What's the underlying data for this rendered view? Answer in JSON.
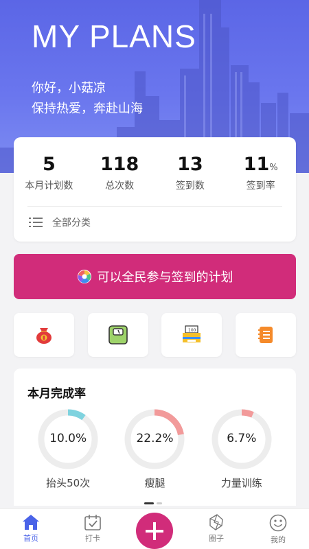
{
  "hero": {
    "title": "MY PLANS",
    "greeting": "你好，小菇凉",
    "slogan": "保持热爱，奔赴山海"
  },
  "stats": [
    {
      "value": "5",
      "unit": "",
      "label": "本月计划数"
    },
    {
      "value": "118",
      "unit": "",
      "label": "总次数"
    },
    {
      "value": "13",
      "unit": "",
      "label": "签到数"
    },
    {
      "value": "11",
      "unit": "%",
      "label": "签到率"
    }
  ],
  "category": {
    "label": "全部分类",
    "icon": "list-icon"
  },
  "banner": {
    "text": "可以全民参与签到的计划",
    "icon": "color-wheel-icon",
    "color": "#d12c7a"
  },
  "tiles": [
    {
      "icon": "money-bag-icon"
    },
    {
      "icon": "scale-icon"
    },
    {
      "icon": "cash-register-icon"
    },
    {
      "icon": "notebook-icon"
    }
  ],
  "progress": {
    "title": "本月完成率",
    "rings": [
      {
        "label": "抬头50次",
        "percent_text": "10.0%",
        "percent": 10.0,
        "color": "#7fd3df"
      },
      {
        "label": "瘦腿",
        "percent_text": "22.2%",
        "percent": 22.2,
        "color": "#f29a9a"
      },
      {
        "label": "力量训练",
        "percent_text": "6.7%",
        "percent": 6.7,
        "color": "#f29a9a"
      }
    ]
  },
  "tabbar": {
    "tabs": [
      {
        "label": "首页",
        "icon": "home-icon",
        "active": true
      },
      {
        "label": "打卡",
        "icon": "calendar-check-icon",
        "active": false
      },
      {
        "label": "",
        "icon": "plus-icon",
        "active": false
      },
      {
        "label": "圈子",
        "icon": "aperture-icon",
        "active": false
      },
      {
        "label": "我的",
        "icon": "smile-icon",
        "active": false
      }
    ]
  },
  "colors": {
    "accent": "#d12c7a",
    "primary": "#4a63e8",
    "hero": "#5b66e6"
  }
}
